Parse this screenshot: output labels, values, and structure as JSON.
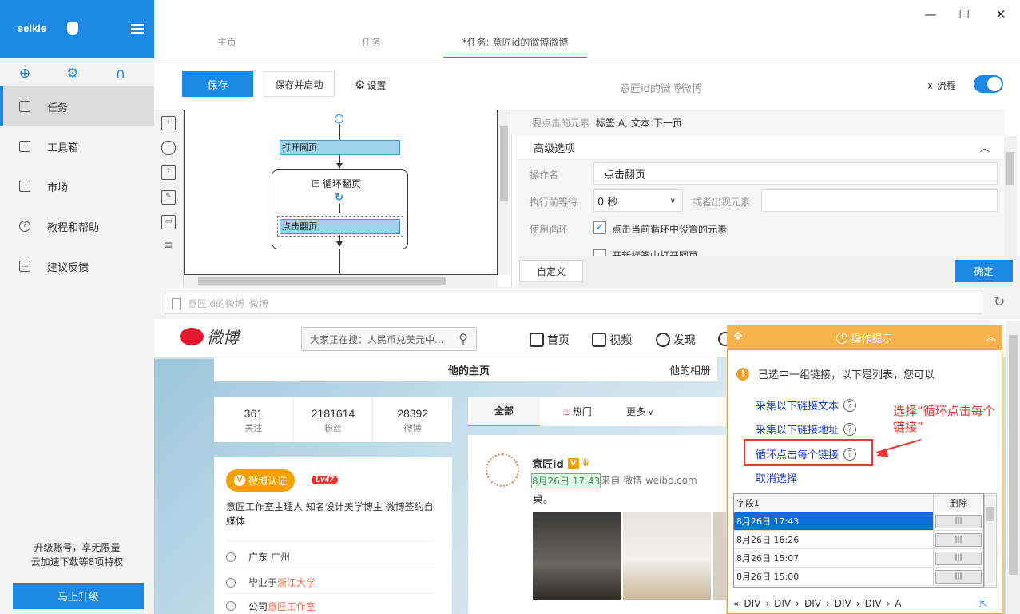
{
  "app": {
    "user": "selkie",
    "window_min": "—",
    "window_max": "☐",
    "window_close": "✕"
  },
  "sidebar": {
    "items": [
      {
        "label": "任务",
        "active": true
      },
      {
        "label": "工具箱"
      },
      {
        "label": "市场"
      },
      {
        "label": "教程和帮助"
      },
      {
        "label": "建议反馈"
      }
    ],
    "promo_line1": "升级账号，享无限量",
    "promo_line2": "云加速下载等8项特权",
    "upgrade_label": "马上升级"
  },
  "tabs": [
    "主页",
    "任务",
    "*任务: 意匠id的微博微博"
  ],
  "toolbar": {
    "save": "保存",
    "save_start": "保存并启动",
    "settings": "设置",
    "task_title": "意匠id的微博微博",
    "flow": "流程",
    "flow_on": true
  },
  "canvas": {
    "node_open": "打开网页",
    "loop_title": "循环翻页",
    "node_click": "点击翻页"
  },
  "config": {
    "target_label": "要点击的元素",
    "target_value": "标签:A, 文本:下一页",
    "adv_title": "高级选项",
    "op_name_label": "操作名",
    "op_name_value": "点击翻页",
    "wait_label": "执行前等待",
    "wait_value": "0 秒",
    "or_appear_label": "或者出现元素",
    "loop_label": "使用循环",
    "loop_checked": true,
    "loop_text": "点击当前循环中设置的元素",
    "cut_text": "开新标签中打开网页",
    "custom_btn": "自定义",
    "ok_btn": "确定"
  },
  "address": {
    "url": "意匠id的微博_微博"
  },
  "weibo": {
    "logo": "微博",
    "search_placeholder": "大家正在搜：人民币兑美元中...",
    "nav": [
      "首页",
      "视频",
      "发现"
    ],
    "tabs": [
      "他的主页",
      "他的相册"
    ],
    "stats": [
      {
        "n": "361",
        "l": "关注"
      },
      {
        "n": "2181614",
        "l": "粉丝"
      },
      {
        "n": "28392",
        "l": "微博"
      }
    ],
    "badge": "微博认证",
    "level": "Lv47",
    "bio": "意匠工作室主理人 知名设计美学博主 微博签约自媒体",
    "info": [
      {
        "pre": "广东 广州",
        "link": ""
      },
      {
        "pre": "毕业于 ",
        "link": "浙江大学"
      },
      {
        "pre": "公司 ",
        "link": "意匠工作室"
      }
    ],
    "feed_tabs": [
      "全部",
      "热门",
      "更多"
    ],
    "author": "意匠id",
    "post_time": "8月26日 17:43",
    "post_source": "来自 微博 weibo.com",
    "post_text": "桌。"
  },
  "popup": {
    "title": "操作提示",
    "msg": "已选中一组链接，以下是列表，您可以",
    "links": [
      "采集以下链接文本",
      "采集以下链接地址",
      "循环点击每个链接",
      "取消选择"
    ],
    "note": "选择“循环点击每个链接”",
    "table_header": [
      "字段1",
      "删除"
    ],
    "rows": [
      "8月26日 17:43",
      "8月26日 16:26",
      "8月26日 15:07",
      "8月26日 15:00"
    ],
    "path": [
      "DIV",
      "DIV",
      "DIV",
      "DIV",
      "DIV",
      "A"
    ]
  },
  "colors": {
    "accent": "#1e88e5",
    "popup_header": "#f6b24b",
    "annotation": "#e53935"
  }
}
